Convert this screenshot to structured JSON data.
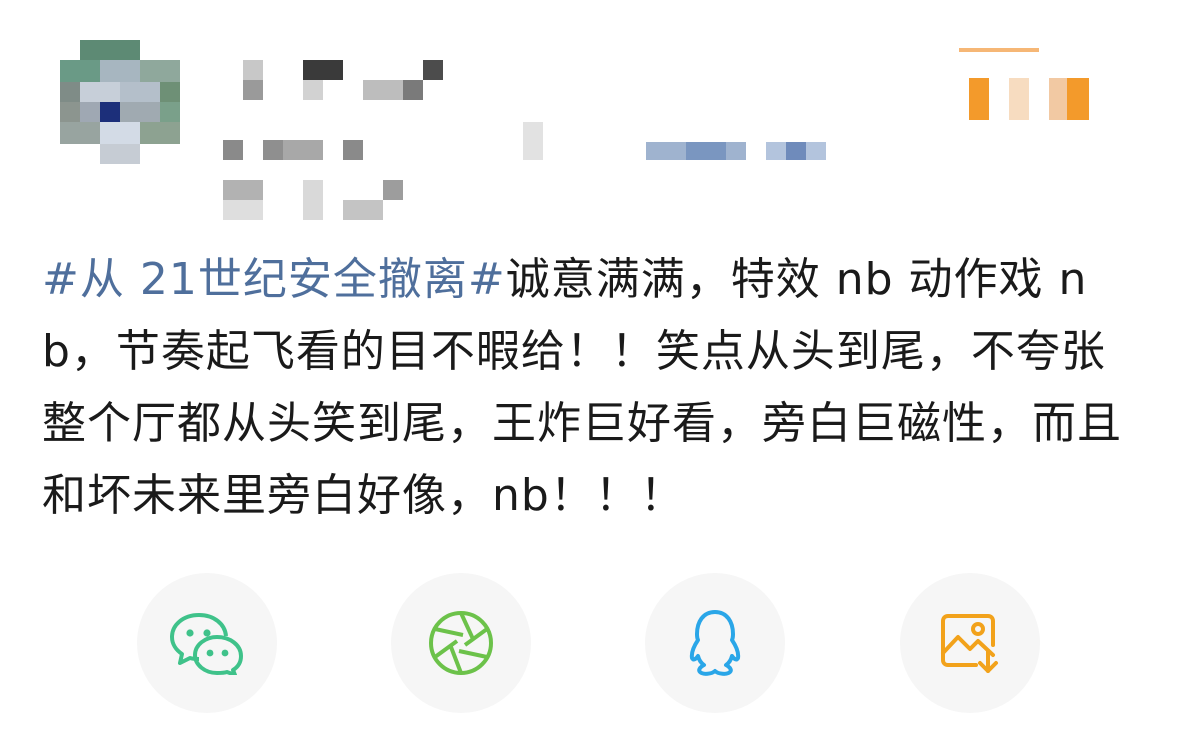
{
  "post": {
    "hashtag": "#从 21世纪安全撤离#",
    "body": "诚意满满，特效 nb 动作戏 nb，节奏起飞看的目不暇给！！笑点从头到尾，不夸张整个厅都从头笑到尾，王炸巨好看，旁白巨磁性，而且和坏未来里旁白好像，nb！！！"
  },
  "header": {
    "avatar_icon": "pixelated-avatar",
    "username_redacted": true
  },
  "share": {
    "items": [
      {
        "id": "wechat",
        "icon": "wechat-icon",
        "color": "#3fc28a"
      },
      {
        "id": "moments",
        "icon": "moments-icon",
        "color": "#6cc24a"
      },
      {
        "id": "qq",
        "icon": "qq-icon",
        "color": "#2aa6e8"
      },
      {
        "id": "save-image",
        "icon": "save-image-icon",
        "color": "#f2a21b"
      }
    ]
  },
  "colors": {
    "hashtag": "#4f6f9c",
    "text": "#1a1a1a",
    "button_bg": "#f6f6f6",
    "brand_orange": "#f39a2b"
  }
}
